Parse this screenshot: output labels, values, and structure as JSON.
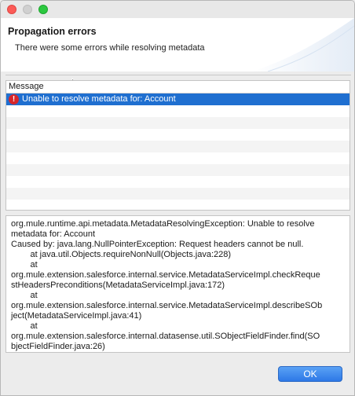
{
  "header": {
    "title": "Propagation errors",
    "message": "There were some errors while resolving metadata"
  },
  "table": {
    "column_header": "Message",
    "rows": [
      {
        "icon": "error-icon",
        "text": "Unable to resolve metadata for: Account"
      }
    ]
  },
  "details": {
    "lines": [
      "org.mule.runtime.api.metadata.MetadataResolvingException: Unable to resolve",
      "metadata for: Account",
      "Caused by: java.lang.NullPointerException: Request headers cannot be null.",
      "        at java.util.Objects.requireNonNull(Objects.java:228)",
      "        at",
      "org.mule.extension.salesforce.internal.service.MetadataServiceImpl.checkReque",
      "stHeadersPreconditions(MetadataServiceImpl.java:172)",
      "        at",
      "org.mule.extension.salesforce.internal.service.MetadataServiceImpl.describeSOb",
      "ject(MetadataServiceImpl.java:41)",
      "        at",
      "org.mule.extension.salesforce.internal.datasense.util.SObjectFieldFinder.find(SO",
      "bjectFieldFinder.java:26)"
    ]
  },
  "buttons": {
    "ok_label": "OK"
  },
  "colors": {
    "selection": "#1f6fd0",
    "error": "#d7262b",
    "button": "#2d78e6"
  }
}
